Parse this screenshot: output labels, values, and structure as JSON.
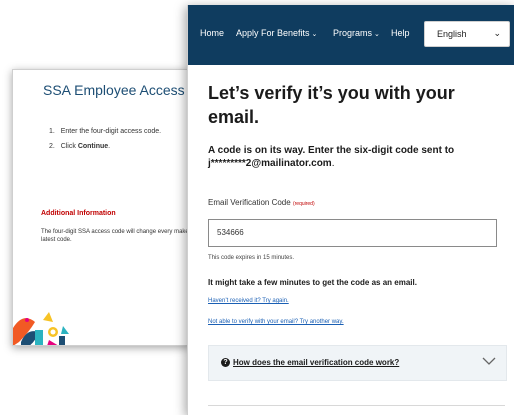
{
  "background_window": {
    "title": "SSA Employee Access Code",
    "steps": [
      {
        "prefix": "1.",
        "text": "Enter the four-digit access code."
      },
      {
        "prefix": "2.",
        "text": "Click ",
        "bold": "Continue",
        "suffix": "."
      }
    ],
    "additional_heading": "Additional Information",
    "additional_text": "The four-digit SSA access code will change every make sure you have the latest code."
  },
  "nav": {
    "items": [
      {
        "label": "Home",
        "dropdown": false
      },
      {
        "label": "Apply For Benefits",
        "dropdown": true
      },
      {
        "label": "Programs",
        "dropdown": true
      },
      {
        "label": "Help",
        "dropdown": false
      }
    ],
    "language": "English"
  },
  "main": {
    "title": "Let’s verify it’s you with your email.",
    "subtitle": "A code is on its way. Enter the six-digit code sent to",
    "email": "j*********2@mailinator.com",
    "field_label": "Email Verification Code",
    "required_marker": "(required)",
    "code_value": "534666",
    "expires": "This code expires in 15 minutes.",
    "wait_msg": "It might take a few minutes to get the code as an email.",
    "link_try_again": "Haven’t received it? Try again.",
    "link_another_way": "Not able to verify with your email? Try another way.",
    "accordion_label": "How does the email verification code work?"
  }
}
